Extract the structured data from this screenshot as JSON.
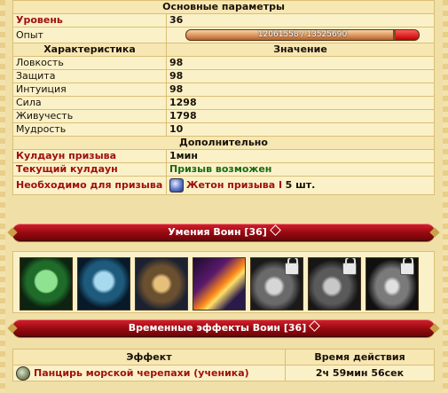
{
  "main_params": {
    "header": "Основные параметры",
    "level_label": "Уровень",
    "level_value": "36",
    "xp_label": "Опыт",
    "xp_text": "12061558 / 13525690",
    "xp_progress": 0.89
  },
  "stats": {
    "header_name": "Характеристика",
    "header_value": "Значение",
    "rows": [
      {
        "label": "Ловкость",
        "value": "98"
      },
      {
        "label": "Защита",
        "value": "98"
      },
      {
        "label": "Интуиция",
        "value": "98"
      },
      {
        "label": "Сила",
        "value": "1298"
      },
      {
        "label": "Живучесть",
        "value": "1798"
      },
      {
        "label": "Мудрость",
        "value": "10"
      }
    ]
  },
  "extra": {
    "header": "Дополнительно",
    "cooldown_label": "Кулдаун призыва",
    "cooldown_value": "1мин",
    "current_cd_label": "Текущий кулдаун",
    "current_cd_value": "Призыв возможен",
    "required_label": "Необходимо для призыва",
    "required_item": "Жетон призыва I",
    "required_qty": "5 шт."
  },
  "skills_banner": "Умения Воин [36]",
  "skills": [
    {
      "icon": "shield-emblem-icon",
      "locked": false
    },
    {
      "icon": "warrior-emblem-icon",
      "locked": false
    },
    {
      "icon": "dual-blade-warrior-icon",
      "locked": false
    },
    {
      "icon": "fire-blade-icon",
      "locked": false
    },
    {
      "icon": "locked-rage-icon",
      "locked": true
    },
    {
      "icon": "locked-creatures-icon",
      "locked": true
    },
    {
      "icon": "locked-armor-icon",
      "locked": true
    }
  ],
  "effects_banner": "Временные эффекты Воин [36]",
  "effects": {
    "header_effect": "Эффект",
    "header_duration": "Время действия",
    "rows": [
      {
        "name": "Панцирь морской черепахи (ученика)",
        "duration": "2ч 59мин 56сек",
        "icon": "turtle-shell-icon"
      }
    ]
  },
  "colors": {
    "label_red": "#a01010",
    "status_green": "#166b16",
    "banner_red": "#9a0a12",
    "panel_bg": "#fbf1c8"
  }
}
